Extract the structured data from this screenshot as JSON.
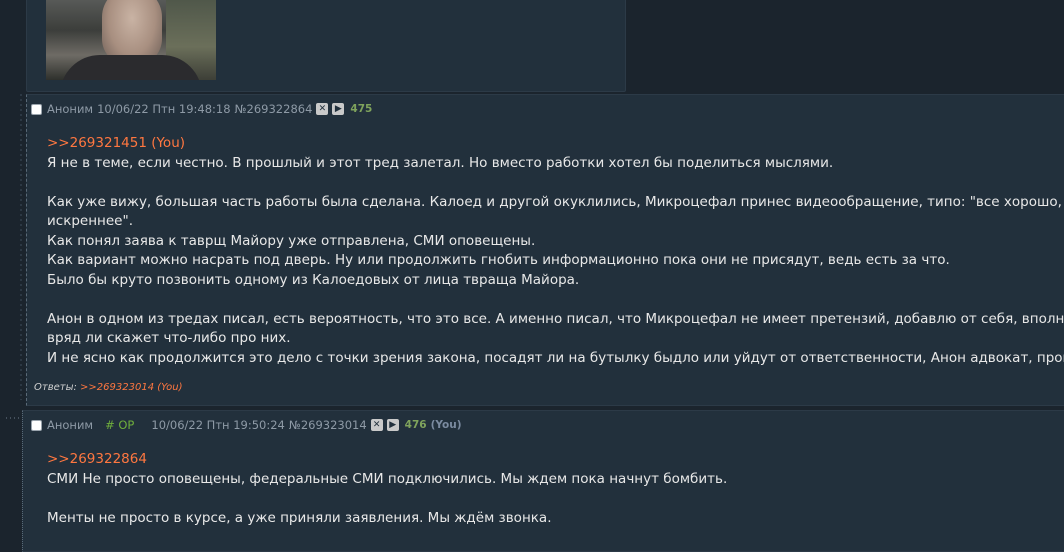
{
  "post1": {
    "author": "Аноним",
    "date": "10/06/22 Птн 19:48:18",
    "number": "№269322864",
    "ordinal": "475",
    "quote": ">>269321451 (You)",
    "lines": [
      "Я не в теме, если честно. В прошлый и этот тред залетал. Но вместо работки хотел бы поделиться мыслями.",
      "",
      "Как уже вижу, большая часть работы была сделана. Калоед и другой окуклились, Микроцефал принес видеообращение, типо: \"все хорошо, вы т",
      "искреннее\".",
      "Как понял заява к таврщ Майору уже отправлена, СМИ оповещены.",
      "Как вариант можно насрать под дверь. Ну или продолжить гнобить информационно пока они не присядут, ведь есть за что.",
      "Было бы круто позвонить одному из Калоедовых от лица твраща Майора.",
      "",
      "Анон в одном из тредах писал, есть вероятность, что это все. А именно писал, что Микроцефал не имеет претензий, добавлю от себя, вполне во",
      "вряд ли скажет что-либо про них.",
      "И не ясно как продолжится это дело с точки зрения закона, посадят ли на бутылку быдло или уйдут от ответственности, Анон адвокат, прошу ра"
    ],
    "replies_label": "Ответы:",
    "replies_link": ">>269323014 (You)"
  },
  "post2": {
    "author": "Аноним",
    "op": "# OP",
    "date": "10/06/22 Птн 19:50:24",
    "number": "№269323014",
    "ordinal": "476",
    "you": "(You)",
    "quote": ">>269322864",
    "lines": [
      "СМИ Не просто оповещены, федеральные СМИ подключились. Мы ждем пока начнут бомбить.",
      "",
      "Менты не просто в курсе, а уже приняли заявления. Мы ждём звонка."
    ]
  },
  "icons": {
    "hide": "close-icon",
    "play": "play-icon"
  },
  "colors": {
    "background": "#1b242d",
    "post_bg": "#22303c",
    "reply_link": "#ff7740",
    "post_number": "#7fa35c",
    "op_tag": "#6fae3c"
  }
}
